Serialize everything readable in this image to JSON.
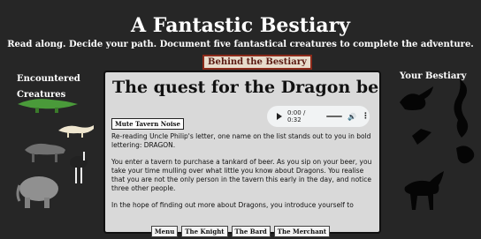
{
  "header": {
    "title": "A Fantastic Bestiary",
    "subtitle": "Read along. Decide your path. Document five fantastical creatures to complete the adventure."
  },
  "left_panel": {
    "heading": "Encountered Creatures"
  },
  "right_panel": {
    "heading": "Your Bestiary"
  },
  "behind_button": "Behind the Bestiary",
  "card": {
    "title": "The quest for the Dragon begins",
    "audio": {
      "time": "0:00 / 0:32"
    },
    "mute_label": "Mute Tavern Noise",
    "paragraphs": [
      "Re-reading Uncle Philip's letter, one name on the list stands out to you in bold lettering: DRAGON.",
      "You enter a tavern to purchase a tankard of beer. As you sip on your beer, you take your time mulling over what little you know about Dragons. You realise that you are not the only person in the tavern this early in the day, and notice three other people.",
      "In the hope of finding out more about Dragons, you introduce yourself to"
    ]
  },
  "nav": [
    "Menu",
    "The Knight",
    "The Bard",
    "The Merchant"
  ],
  "icons": [
    "play-icon",
    "volume-icon",
    "more-options-icon"
  ]
}
